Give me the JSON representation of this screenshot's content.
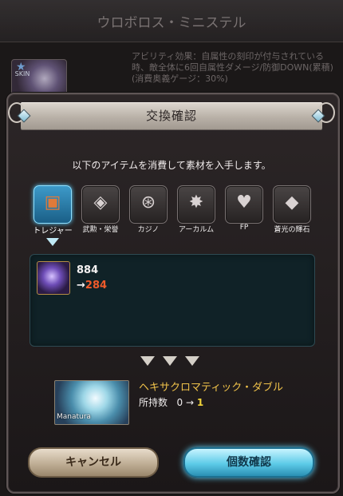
{
  "background": {
    "title": "ウロボロス・ミニステル",
    "skin_badge": "SKIN",
    "ability_desc": "アビリティ効果：自属性の刻印が付与されている時、敵全体に6回自属性ダメージ/防御DOWN(累積)",
    "ability_cost": "(消費奥義ゲージ：30%)"
  },
  "dialog": {
    "title": "交換確認",
    "instruction": "以下のアイテムを消費して素材を入手します。",
    "tabs": [
      {
        "label": "トレジャー",
        "icon": "chest-icon",
        "active": true
      },
      {
        "label": "武勲・栄誉",
        "icon": "medal-icon",
        "active": false
      },
      {
        "label": "カジノ",
        "icon": "casino-chip-icon",
        "active": false
      },
      {
        "label": "アーカルム",
        "icon": "star-burst-icon",
        "active": false
      },
      {
        "label": "FP",
        "icon": "heart-icon",
        "active": false
      },
      {
        "label": "蒼光の輝石",
        "icon": "crystal-icon",
        "active": false
      }
    ],
    "consumed_item": {
      "before": "884",
      "arrow": "→",
      "after": "284"
    },
    "result_item": {
      "name": "ヘキサクロマティック・ダブル",
      "owned_label": "所持数",
      "owned_before": "0",
      "owned_arrow": "→",
      "owned_after": "1",
      "tag": "Manatura"
    },
    "buttons": {
      "cancel": "キャンセル",
      "confirm": "個数確認"
    }
  },
  "colors": {
    "accent_blue": "#5dcbe8",
    "count_after": "#f05a2a",
    "result_name": "#f0c24a"
  }
}
